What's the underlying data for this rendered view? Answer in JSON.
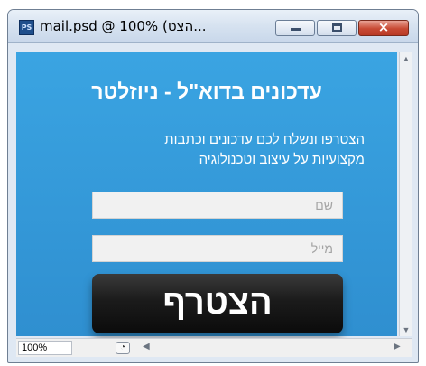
{
  "window": {
    "title": "mail.psd @ 100% (הצט...",
    "app_icon": "PS",
    "buttons": {
      "minimize": "minimize-icon",
      "maximize": "maximize-icon",
      "close": "×"
    }
  },
  "newsletter": {
    "title": "עדכונים בדוא\"ל - ניוזלטר",
    "description_line1": "הצטרפו ונשלח לכם עדכונים וכתבות",
    "description_line2": "מקצועיות על עיצוב וטכנולוגיה",
    "name_placeholder": "שם",
    "email_placeholder": "מייל",
    "join_button": "הצטרף"
  },
  "statusbar": {
    "zoom": "100%",
    "scroll_left": "◀",
    "scroll_right": "▶"
  },
  "scrollbar": {
    "up": "▲",
    "down": "▼"
  },
  "colors": {
    "canvas_background": "#3aa4e2",
    "button_background": "#1b1b1b",
    "field_background": "#f1f1f1"
  }
}
